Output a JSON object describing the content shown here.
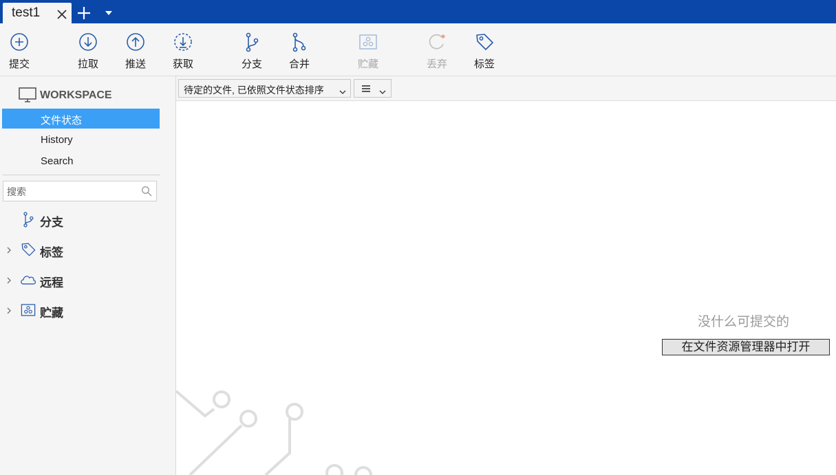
{
  "tabbar": {
    "tab_title": "test1",
    "icons": [
      "close-icon",
      "plus-icon",
      "caret-down-icon"
    ],
    "background_color": "#0a47a9"
  },
  "toolbar": {
    "commit": "提交",
    "pull": "拉取",
    "push": "推送",
    "fetch": "获取",
    "branch": "分支",
    "merge": "合并",
    "stash": "贮藏",
    "discard": "丢弃",
    "tag": "标签",
    "disabled": [
      "stash",
      "discard"
    ]
  },
  "sidebar": {
    "workspace_label": "WORKSPACE",
    "nav": {
      "file_status": "文件状态",
      "history": "History",
      "search": "Search"
    },
    "active_item": "file_status",
    "accent_color": "#3a9ff5",
    "search_placeholder": "搜索",
    "tree": {
      "branches": "分支",
      "tags": "标签",
      "remotes": "远程",
      "stashes": "贮藏"
    }
  },
  "main": {
    "sort_option": "待定的文件, 已依照文件状态排序",
    "view_option_icon": "list-icon",
    "empty_message": "没什么可提交的",
    "open_in_explorer": "在文件资源管理器中打开"
  }
}
